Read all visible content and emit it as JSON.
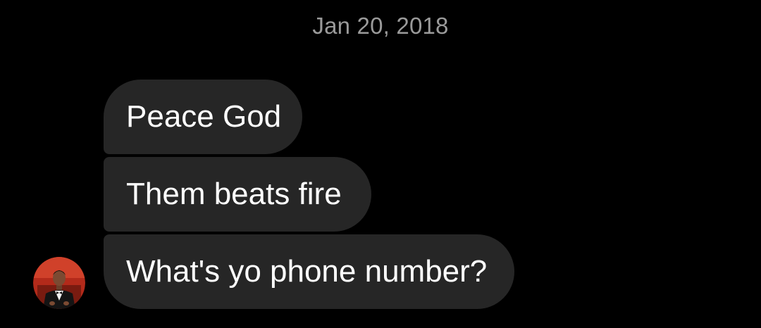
{
  "conversation": {
    "date_header": "Jan 20, 2018",
    "messages": [
      {
        "text": "Peace God"
      },
      {
        "text": "Them beats fire"
      },
      {
        "text": "What's yo phone number?"
      }
    ],
    "sender": {
      "avatar_icon": "profile-photo-avatar"
    }
  },
  "colors": {
    "background": "#000000",
    "bubble": "#262626",
    "bubble_text": "#ffffff",
    "date_text": "#9a9a9a",
    "avatar_bg": "#c0321f"
  }
}
